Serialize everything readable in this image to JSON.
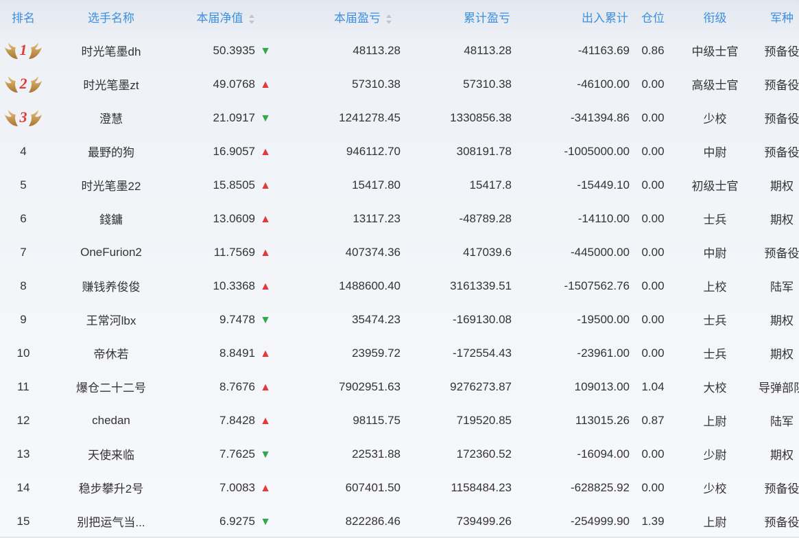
{
  "headers": {
    "rank": "排名",
    "name": "选手名称",
    "nav": "本届净值",
    "current_pl": "本届盈亏",
    "cumulative_pl": "累计盈亏",
    "flow": "出入累计",
    "position": "仓位",
    "grade": "衔级",
    "arm": "军种"
  },
  "colors": {
    "header_text": "#3d8fe0",
    "up_arrow": "#e23a3a",
    "down_arrow": "#2fa84f",
    "medal_number": "#e23a3a"
  },
  "arrow_icons": {
    "up": "▲",
    "down": "▼"
  },
  "rows": [
    {
      "rank": "1",
      "name": "时光笔墨dh",
      "nav": "50.3935",
      "trend": "down",
      "current_pl": "48113.28",
      "cumulative_pl": "48113.28",
      "flow": "-41163.69",
      "position": "0.86",
      "grade": "中级士官",
      "arm": "预备役"
    },
    {
      "rank": "2",
      "name": "时光笔墨zt",
      "nav": "49.0768",
      "trend": "up",
      "current_pl": "57310.38",
      "cumulative_pl": "57310.38",
      "flow": "-46100.00",
      "position": "0.00",
      "grade": "高级士官",
      "arm": "预备役"
    },
    {
      "rank": "3",
      "name": "澄慧",
      "nav": "21.0917",
      "trend": "down",
      "current_pl": "1241278.45",
      "cumulative_pl": "1330856.38",
      "flow": "-341394.86",
      "position": "0.00",
      "grade": "少校",
      "arm": "预备役"
    },
    {
      "rank": "4",
      "name": "最野的狗",
      "nav": "16.9057",
      "trend": "up",
      "current_pl": "946112.70",
      "cumulative_pl": "308191.78",
      "flow": "-1005000.00",
      "position": "0.00",
      "grade": "中尉",
      "arm": "预备役"
    },
    {
      "rank": "5",
      "name": "时光笔墨22",
      "nav": "15.8505",
      "trend": "up",
      "current_pl": "15417.80",
      "cumulative_pl": "15417.8",
      "flow": "-15449.10",
      "position": "0.00",
      "grade": "初级士官",
      "arm": "期权"
    },
    {
      "rank": "6",
      "name": "錢鏞",
      "nav": "13.0609",
      "trend": "up",
      "current_pl": "13117.23",
      "cumulative_pl": "-48789.28",
      "flow": "-14110.00",
      "position": "0.00",
      "grade": "士兵",
      "arm": "期权"
    },
    {
      "rank": "7",
      "name": "OneFurion2",
      "nav": "11.7569",
      "trend": "up",
      "current_pl": "407374.36",
      "cumulative_pl": "417039.6",
      "flow": "-445000.00",
      "position": "0.00",
      "grade": "中尉",
      "arm": "预备役"
    },
    {
      "rank": "8",
      "name": "赚钱养俊俊",
      "nav": "10.3368",
      "trend": "up",
      "current_pl": "1488600.40",
      "cumulative_pl": "3161339.51",
      "flow": "-1507562.76",
      "position": "0.00",
      "grade": "上校",
      "arm": "陆军"
    },
    {
      "rank": "9",
      "name": "王常河lbx",
      "nav": "9.7478",
      "trend": "down",
      "current_pl": "35474.23",
      "cumulative_pl": "-169130.08",
      "flow": "-19500.00",
      "position": "0.00",
      "grade": "士兵",
      "arm": "期权"
    },
    {
      "rank": "10",
      "name": "帝休若",
      "nav": "8.8491",
      "trend": "up",
      "current_pl": "23959.72",
      "cumulative_pl": "-172554.43",
      "flow": "-23961.00",
      "position": "0.00",
      "grade": "士兵",
      "arm": "期权"
    },
    {
      "rank": "11",
      "name": "爆仓二十二号",
      "nav": "8.7676",
      "trend": "up",
      "current_pl": "7902951.63",
      "cumulative_pl": "9276273.87",
      "flow": "109013.00",
      "position": "1.04",
      "grade": "大校",
      "arm": "导弹部队"
    },
    {
      "rank": "12",
      "name": "chedan",
      "nav": "7.8428",
      "trend": "up",
      "current_pl": "98115.75",
      "cumulative_pl": "719520.85",
      "flow": "113015.26",
      "position": "0.87",
      "grade": "上尉",
      "arm": "陆军"
    },
    {
      "rank": "13",
      "name": "天使来临",
      "nav": "7.7625",
      "trend": "down",
      "current_pl": "22531.88",
      "cumulative_pl": "172360.52",
      "flow": "-16094.00",
      "position": "0.00",
      "grade": "少尉",
      "arm": "期权"
    },
    {
      "rank": "14",
      "name": "稳步攀升2号",
      "nav": "7.0083",
      "trend": "up",
      "current_pl": "607401.50",
      "cumulative_pl": "1158484.23",
      "flow": "-628825.92",
      "position": "0.00",
      "grade": "少校",
      "arm": "预备役"
    },
    {
      "rank": "15",
      "name": "别把运气当...",
      "nav": "6.9275",
      "trend": "down",
      "current_pl": "822286.46",
      "cumulative_pl": "739499.26",
      "flow": "-254999.90",
      "position": "1.39",
      "grade": "上尉",
      "arm": "预备役"
    }
  ]
}
